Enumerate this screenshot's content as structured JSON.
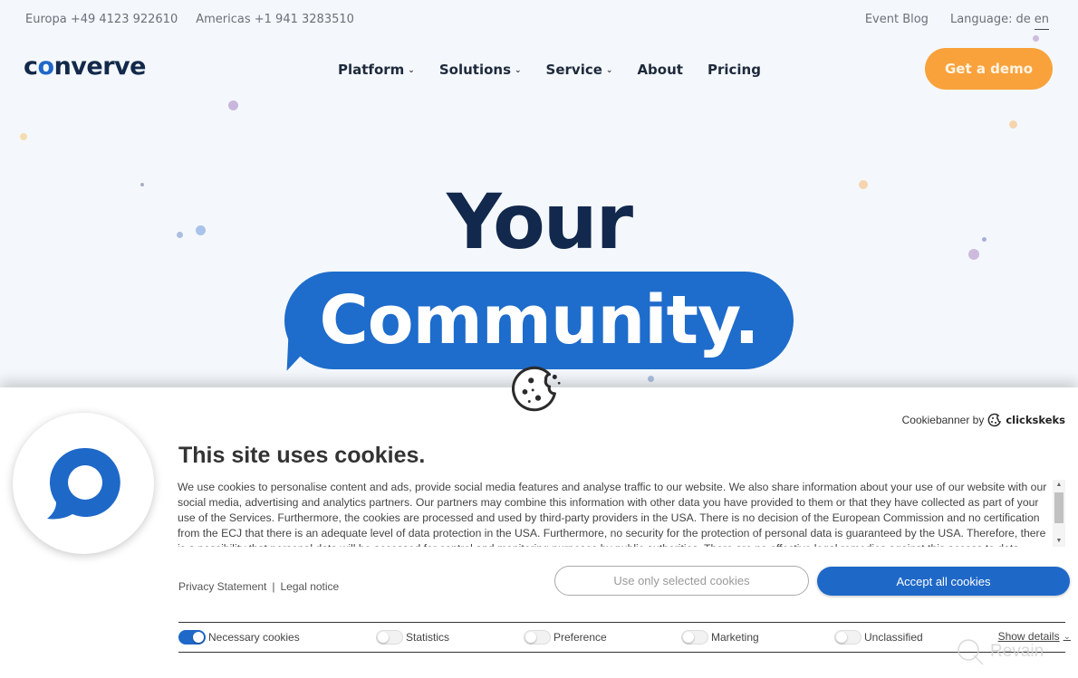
{
  "topbar": {
    "phones": [
      "Europa +49 4123 922610",
      "Americas +1 941 3283510"
    ],
    "event_blog": "Event Blog",
    "language_label": "Language:",
    "languages": [
      "de",
      "en"
    ],
    "active_language": "en"
  },
  "logo": {
    "pre": "c",
    "o": "o",
    "post": "nverve"
  },
  "nav": {
    "items": [
      {
        "label": "Platform",
        "has_dropdown": true
      },
      {
        "label": "Solutions",
        "has_dropdown": true
      },
      {
        "label": "Service",
        "has_dropdown": true
      },
      {
        "label": "About",
        "has_dropdown": false
      },
      {
        "label": "Pricing",
        "has_dropdown": false
      }
    ],
    "chevron": "⌄",
    "cta_label": "Get a demo"
  },
  "hero": {
    "line1": "Your",
    "line2": "Community."
  },
  "cookie_banner": {
    "powered_by_label": "Cookiebanner by",
    "powered_by_brand": "clickskeks",
    "title": "This site uses cookies.",
    "body": "We use cookies to personalise content and ads, provide social media features and analyse traffic to our website. We also share information about your use of our website with our social media, advertising and analytics partners. Our partners may combine this information with other data you have provided to them or that they have collected as part of your use of the Services. Furthermore, the cookies are processed and used by third-party providers in the USA. There is no decision of the European Commission and no certification from the ECJ that there is an adequate level of data protection in the USA. Furthermore, no security for the protection of personal data is guaranteed by the USA. Therefore, there is a possibility that personal data will be accessed for control and monitoring purposes by public authorities. There are no effective legal remedies against this access to data.",
    "links": {
      "privacy": "Privacy Statement",
      "separator": "|",
      "legal": "Legal notice"
    },
    "btn_selected": "Use only selected cookies",
    "btn_accept": "Accept all cookies",
    "toggles": [
      {
        "label": "Necessary cookies",
        "checked": true
      },
      {
        "label": "Statistics",
        "checked": false
      },
      {
        "label": "Preference",
        "checked": false
      },
      {
        "label": "Marketing",
        "checked": false
      },
      {
        "label": "Unclassified",
        "checked": false
      }
    ],
    "show_details": "Show details",
    "colors": {
      "accent": "#1e68c8",
      "cta": "#f9a23c",
      "navy": "#12284d"
    }
  },
  "watermark": "Revain"
}
